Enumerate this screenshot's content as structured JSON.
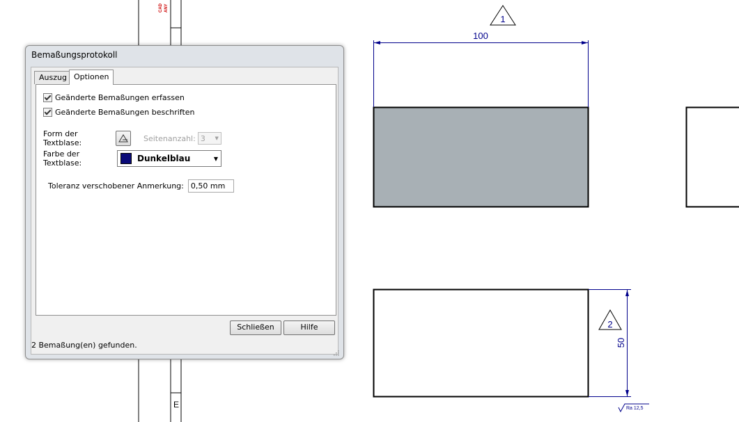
{
  "dialog": {
    "title": "Bemaßungsprotokoll",
    "tabs": [
      {
        "label": "Auszug",
        "active": false
      },
      {
        "label": "Optionen",
        "active": true
      }
    ],
    "options": {
      "checkbox_capture": {
        "label": "Geänderte Bemaßungen erfassen",
        "checked": true
      },
      "checkbox_label": {
        "label": "Geänderte Bemaßungen beschriften",
        "checked": true
      },
      "bubble_shape_label": "Form der Textblase:",
      "bubble_shape_icon": "triangle-icon",
      "sides_label": "Seitenanzahl:",
      "sides_value": "3",
      "bubble_color_label": "Farbe der Textblase:",
      "bubble_color_value": "Dunkelblau",
      "bubble_color_hex": "#0a0a78",
      "tolerance_label": "Toleranz verschobener Anmerkung:",
      "tolerance_value": "0,50 mm"
    },
    "buttons": {
      "close": "Schließen",
      "help": "Hilfe"
    },
    "status": "2 Bemaßung(en) gefunden."
  },
  "drawing": {
    "dimension_top": "100",
    "dimension_right": "50",
    "revision_1": "1",
    "revision_2": "2",
    "surface_symbol": "Ra  12,5",
    "strip_letter": "E",
    "strip_red_text_1": "CAD",
    "strip_red_text_2": "ANY",
    "colors": {
      "dimension": "#00008b",
      "fill": "#a8b0b5"
    }
  }
}
